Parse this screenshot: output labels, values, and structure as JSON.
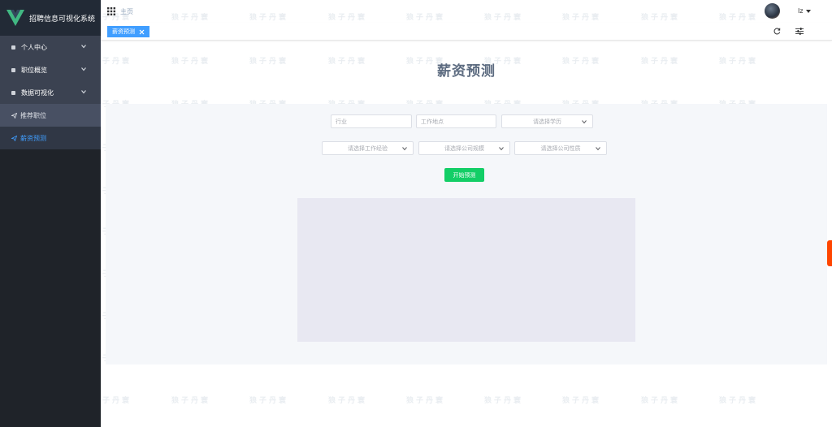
{
  "app": {
    "title": "招聘信息可视化系统"
  },
  "sidebar": {
    "items": [
      {
        "label": "个人中心"
      },
      {
        "label": "职位概览"
      },
      {
        "label": "数据可视化"
      }
    ],
    "sub_items": [
      {
        "label": "推荐职位"
      },
      {
        "label": "薪资预测"
      }
    ]
  },
  "header": {
    "breadcrumb": "主页",
    "user": "lz"
  },
  "tags": {
    "active": "薪资预测"
  },
  "main": {
    "title": "薪资预测",
    "form": {
      "industry_placeholder": "行业",
      "location_placeholder": "工作地点",
      "education_placeholder": "请选择学历",
      "experience_placeholder": "请选择工作经验",
      "company_size_placeholder": "请选择公司规模",
      "company_type_placeholder": "请选择公司性质",
      "submit_label": "开始预测"
    }
  },
  "watermark": "狼子丹寰",
  "colors": {
    "accent": "#409eff",
    "success": "#13ce66",
    "sidebar": "#1f2329"
  }
}
